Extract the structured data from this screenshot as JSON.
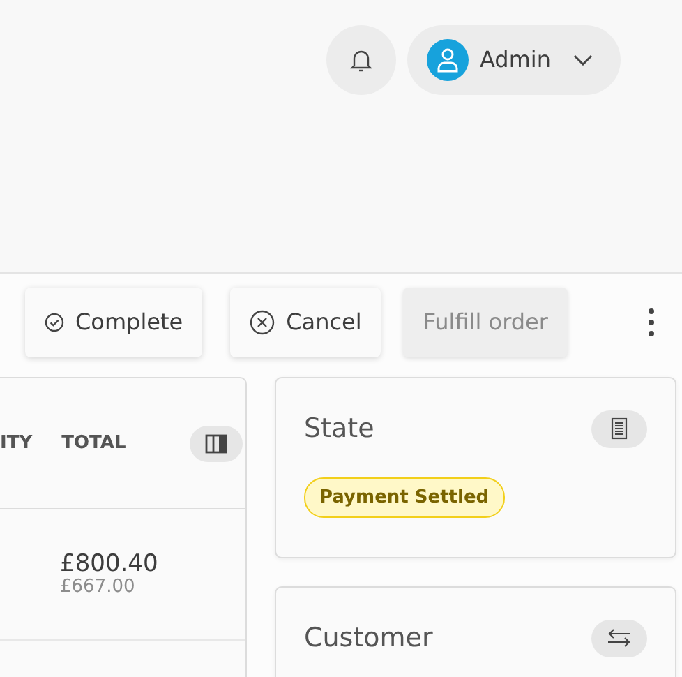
{
  "header": {
    "user": {
      "name": "Admin"
    }
  },
  "actions": [
    {
      "label": "Complete",
      "kind": "complete",
      "disabled": false
    },
    {
      "label": "Cancel",
      "kind": "cancel",
      "disabled": false
    },
    {
      "label": "Fulfill order",
      "kind": "plain",
      "disabled": true
    }
  ],
  "table": {
    "columns": [
      "ITY",
      "TOTAL"
    ],
    "rows": [
      {
        "total": "£800.40",
        "subtotal": "£667.00"
      }
    ]
  },
  "cards": [
    {
      "title": "State",
      "kind": "state",
      "badge": "Payment Settled"
    },
    {
      "title": "Customer",
      "kind": "customer"
    }
  ]
}
